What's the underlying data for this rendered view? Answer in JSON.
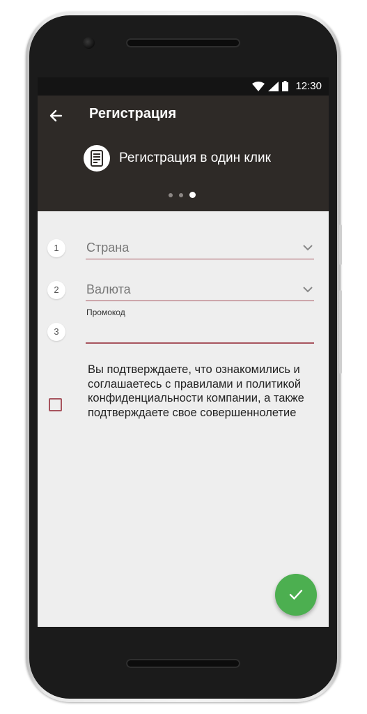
{
  "status_bar": {
    "time": "12:30",
    "icons": [
      "wifi-icon",
      "signal-icon",
      "battery-icon"
    ]
  },
  "app_bar": {
    "title": "Регистрация",
    "back_icon": "arrow-left-icon",
    "promo": {
      "icon": "phone-document-icon",
      "text": "Регистрация в один клик"
    },
    "carousel": {
      "total": 3,
      "active": 3
    }
  },
  "form": {
    "steps": [
      {
        "number": "1",
        "value": "Страна",
        "type": "select"
      },
      {
        "number": "2",
        "value": "Валюта",
        "type": "select"
      },
      {
        "number": "3",
        "label": "Промокод",
        "value": "",
        "type": "text"
      }
    ],
    "consent": {
      "checked": false,
      "text": "Вы подтверждаете, что ознакомились и соглашаетесь с правилами и политикой конфиденциальности компании, а также подтверждаете свое совершеннолетие"
    },
    "submit_icon": "check-icon"
  },
  "colors": {
    "app_bar": "#2e2a27",
    "status_bar": "#141414",
    "accent_line": "#a7545e",
    "fab": "#4caf50",
    "screen_bg": "#eeeeee"
  }
}
